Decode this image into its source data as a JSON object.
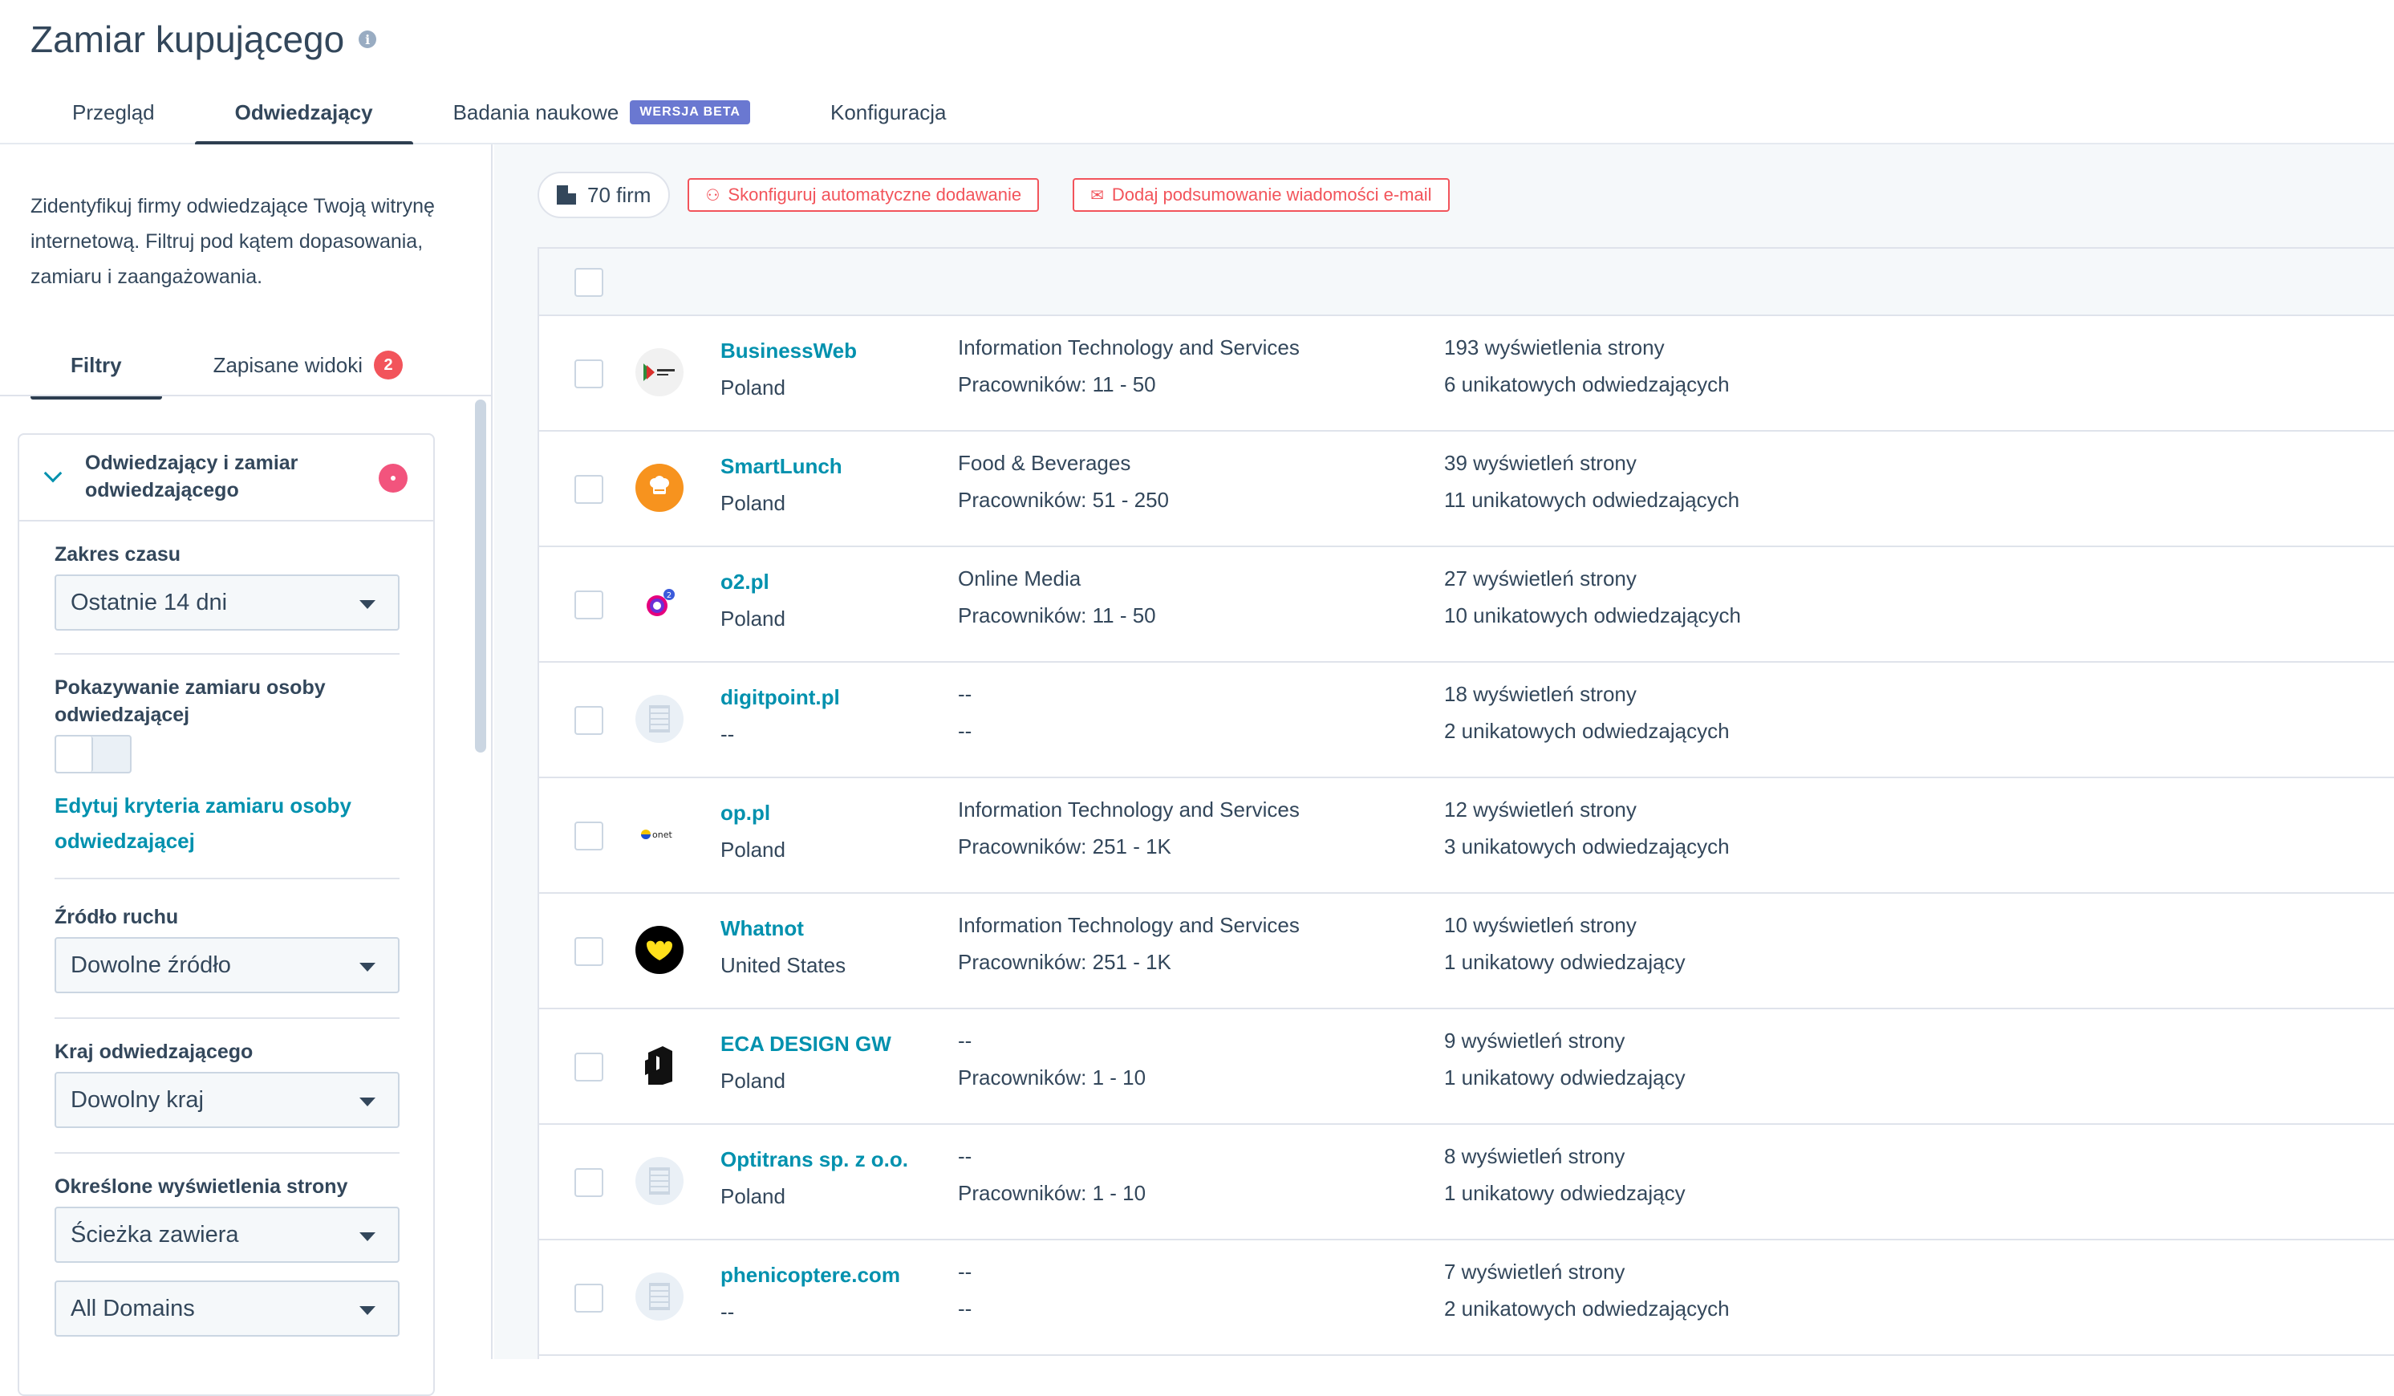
{
  "header": {
    "title": "Zamiar kupującego",
    "tabs": [
      {
        "label": "Przegląd"
      },
      {
        "label": "Odwiedzający"
      },
      {
        "label": "Badania naukowe",
        "badge": "WERSJA BETA"
      },
      {
        "label": "Konfiguracja"
      }
    ]
  },
  "sidebar": {
    "description": "Zidentyfikuj firmy odwiedzające Twoją witrynę internetową. Filtruj pod kątem dopasowania, zamiaru i zaangażowania.",
    "tabs": [
      {
        "label": "Filtry"
      },
      {
        "label": "Zapisane widoki",
        "badge": "2"
      }
    ],
    "filter_group": {
      "title": "Odwiedzający i zamiar odwiedzającego",
      "time_range_label": "Zakres czasu",
      "time_range_value": "Ostatnie 14 dni",
      "intent_label": "Pokazywanie zamiaru osoby odwiedzającej",
      "edit_link": "Edytuj kryteria zamiaru osoby odwiedzającej",
      "source_label": "Źródło ruchu",
      "source_value": "Dowolne źródło",
      "country_label": "Kraj odwiedzającego",
      "country_value": "Dowolny kraj",
      "pageviews_label": "Określone wyświetlenia strony",
      "path_value": "Ścieżka zawiera",
      "domain_value": "All Domains"
    }
  },
  "toolbar": {
    "count": "70 firm",
    "auto_add_button": "Skonfiguruj automatyczne dodawanie",
    "email_summary_button": "Dodaj podsumowanie wiadomości e-mail"
  },
  "companies": [
    {
      "name": "BusinessWeb",
      "country": "Poland",
      "industry": "Information Technology and Services",
      "employees": "Pracowników: 11 - 50",
      "pageviews": "193 wyświetlenia strony",
      "visitors": "6 unikatowych odwiedzających",
      "logo": "businessweb-logo"
    },
    {
      "name": "SmartLunch",
      "country": "Poland",
      "industry": "Food & Beverages",
      "employees": "Pracowników: 51 - 250",
      "pageviews": "39 wyświetleń strony",
      "visitors": "11 unikatowych odwiedzających",
      "logo": "smartlunch-logo"
    },
    {
      "name": "o2.pl",
      "country": "Poland",
      "industry": "Online Media",
      "employees": "Pracowników: 11 - 50",
      "pageviews": "27 wyświetleń strony",
      "visitors": "10 unikatowych odwiedzających",
      "logo": "o2-logo"
    },
    {
      "name": "digitpoint.pl",
      "country": "--",
      "industry": "--",
      "employees": "--",
      "pageviews": "18 wyświetleń strony",
      "visitors": "2 unikatowych odwiedzających",
      "logo": "placeholder-building-icon"
    },
    {
      "name": "op.pl",
      "country": "Poland",
      "industry": "Information Technology and Services",
      "employees": "Pracowników: 251 - 1K",
      "pageviews": "12 wyświetleń strony",
      "visitors": "3 unikatowych odwiedzających",
      "logo": "onet-logo"
    },
    {
      "name": "Whatnot",
      "country": "United States",
      "industry": "Information Technology and Services",
      "employees": "Pracowników: 251 - 1K",
      "pageviews": "10 wyświetleń strony",
      "visitors": "1 unikatowy odwiedzający",
      "logo": "whatnot-logo"
    },
    {
      "name": "ECA DESIGN GW",
      "country": "Poland",
      "industry": "--",
      "employees": "Pracowników: 1 - 10",
      "pageviews": "9 wyświetleń strony",
      "visitors": "1 unikatowy odwiedzający",
      "logo": "eca-logo"
    },
    {
      "name": "Optitrans sp. z o.o.",
      "country": "Poland",
      "industry": "--",
      "employees": "Pracowników: 1 - 10",
      "pageviews": "8 wyświetleń strony",
      "visitors": "1 unikatowy odwiedzający",
      "logo": "placeholder-building-icon"
    },
    {
      "name": "phenicoptere.com",
      "country": "--",
      "industry": "--",
      "employees": "--",
      "pageviews": "7 wyświetleń strony",
      "visitors": "2 unikatowych odwiedzających",
      "logo": "placeholder-building-icon"
    }
  ],
  "colors": {
    "accent_link": "#0091ae",
    "danger": "#f2545b",
    "beta_badge": "#6a78d1",
    "text": "#33475b"
  }
}
